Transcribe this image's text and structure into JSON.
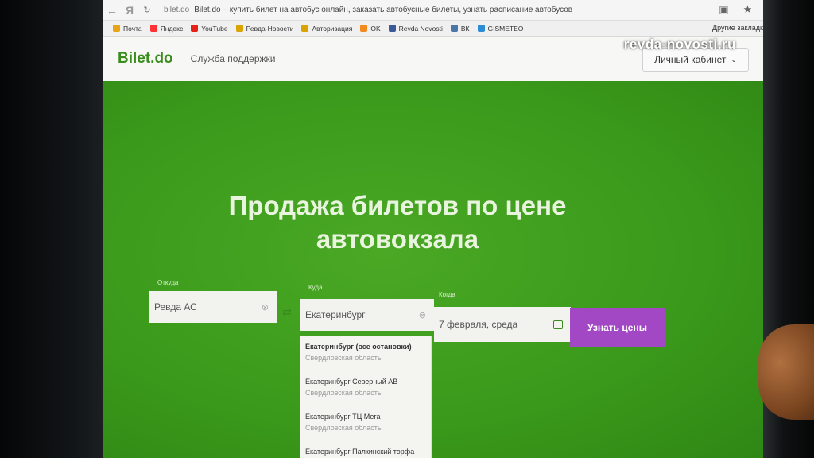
{
  "browser": {
    "back": "←",
    "url_host": "bilet.do",
    "tab_title": "Bilet.do – купить билет на автобус онлайн, заказать автобусные билеты, узнать расписание автобусов",
    "bookmarks": [
      {
        "label": "Почта",
        "color": "#e8a317"
      },
      {
        "label": "Яндекс",
        "color": "#ff3333"
      },
      {
        "label": "YouTube",
        "color": "#e62117"
      },
      {
        "label": "Ревда-Новости",
        "color": "#d9a400"
      },
      {
        "label": "Авторизация",
        "color": "#d9a400"
      },
      {
        "label": "OK",
        "color": "#f28a1e"
      },
      {
        "label": "Revda Novosti",
        "color": "#3b5998"
      },
      {
        "label": "ВК",
        "color": "#4a76a8"
      },
      {
        "label": "GISMETEO",
        "color": "#2d8cd6"
      }
    ],
    "other_bookmarks": "Другие закладки"
  },
  "site": {
    "logo": "Bilet.do",
    "support": "Служба поддержки",
    "cabinet": "Личный кабинет"
  },
  "hero": {
    "title_line1": "Продажа билетов по цене",
    "title_line2": "автовокзала"
  },
  "search": {
    "from_label": "Откуда",
    "from_value": "Ревда АС",
    "to_label": "Куда",
    "to_value": "Екатеринбург",
    "when_label": "Когда",
    "when_value": "7 февраля, среда",
    "button": "Узнать цены"
  },
  "dropdown": [
    {
      "city": "Екатеринбург (все остановки)",
      "region": "Свердловская область"
    },
    {
      "city": "Екатеринбург Северный АВ",
      "region": "Свердловская область"
    },
    {
      "city": "Екатеринбург ТЦ Мега",
      "region": "Свердловская область"
    },
    {
      "city": "Екатеринбург Палкинский торфа",
      "region": ""
    }
  ],
  "watermark": "revda-novosti.ru",
  "colors": {
    "green": "#3b9a1b",
    "purple": "#a348c4",
    "logo_green": "#3a8d1c"
  }
}
